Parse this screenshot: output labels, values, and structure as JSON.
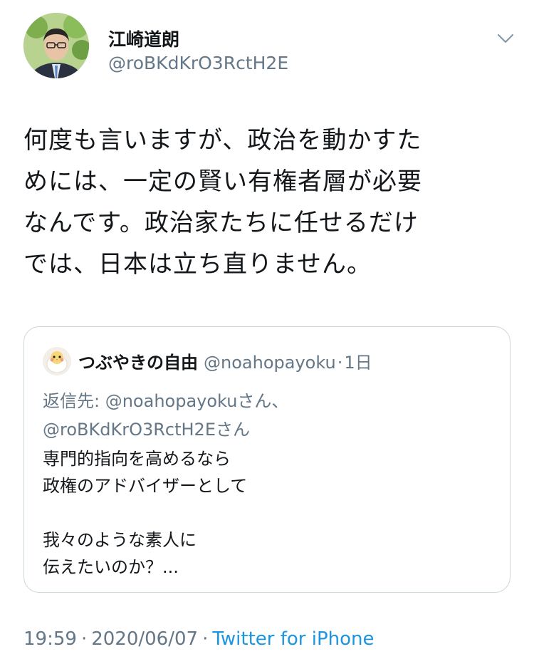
{
  "author": {
    "name": "江崎道朗",
    "handle": "@roBKdKrO3RctH2E"
  },
  "tweet": {
    "lines": [
      "何度も言いますが、政治を動かすた",
      "めには、一定の賢い有権者層が必要",
      "なんです。政治家たちに任せるだけ",
      "では、日本は立ち直りません。"
    ]
  },
  "quoted": {
    "name": "つぶやきの自由",
    "handle": "@noahopayoku",
    "dot": "·",
    "time": "1日",
    "reply_prefix": "返信先: ",
    "reply_to_1": "@noahopayoku",
    "reply_suffix_1": "さん、",
    "reply_to_2": "@roBKdKrO3RctH2E",
    "reply_suffix_2": "さん",
    "body": [
      "専門的指向を高めるなら",
      "政権のアドバイザーとして",
      "",
      "我々のような素人に",
      "伝えたいのか？..."
    ]
  },
  "footer": {
    "time": "19:59",
    "sep": "·",
    "date": "2020/06/07",
    "source": "Twitter for iPhone"
  },
  "icons": {
    "caret": "chevron-down-icon",
    "avatar": "profile-photo",
    "quoted_avatar": "bird-avatar"
  },
  "colors": {
    "primary_text": "#14171a",
    "secondary_text": "#657786",
    "link": "#1b95e0",
    "border": "#ccd6dd"
  }
}
